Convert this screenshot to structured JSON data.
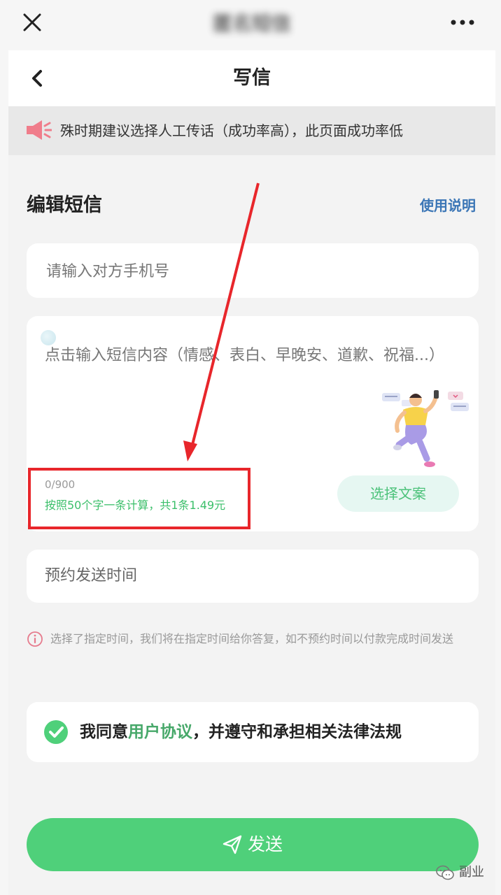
{
  "topbar": {
    "title": "匿名短信",
    "close_icon": "close-icon",
    "more_icon": "more-dots-icon"
  },
  "navbar": {
    "title": "写信",
    "back_icon": "chevron-left-icon"
  },
  "notice": {
    "text": "殊时期建议选择人工传话（成功率高），此页面成功率低",
    "icon": "speaker-icon",
    "icon_color": "#f07d8b"
  },
  "section": {
    "title": "编辑短信",
    "help_link": "使用说明"
  },
  "phone": {
    "placeholder": "请输入对方手机号",
    "value": ""
  },
  "message": {
    "placeholder": "点击输入短信内容（情感、表白、早晚安、道歉、祝福...）",
    "value": "",
    "counter": "0/900",
    "price_note": "按照50个字一条计算，共1条1.49元",
    "choose_button": "选择文案"
  },
  "schedule": {
    "label": "预约发送时间",
    "info": "选择了指定时间，我们将在指定时间给你答复，如不预约时间以付款完成时间发送"
  },
  "agreement": {
    "prefix": "我同意",
    "link": "用户协议",
    "suffix": "，并遵守和承担相关法律法规",
    "checked": true
  },
  "send": {
    "label": "发送",
    "icon": "send-icon"
  },
  "watermark": {
    "text": "副业"
  },
  "colors": {
    "accent_green": "#4fd07a",
    "link_blue": "#3b76b6",
    "price_green": "#3bbf6a",
    "annotation_red": "#e8262b",
    "choose_bg": "#e6f7f2"
  }
}
